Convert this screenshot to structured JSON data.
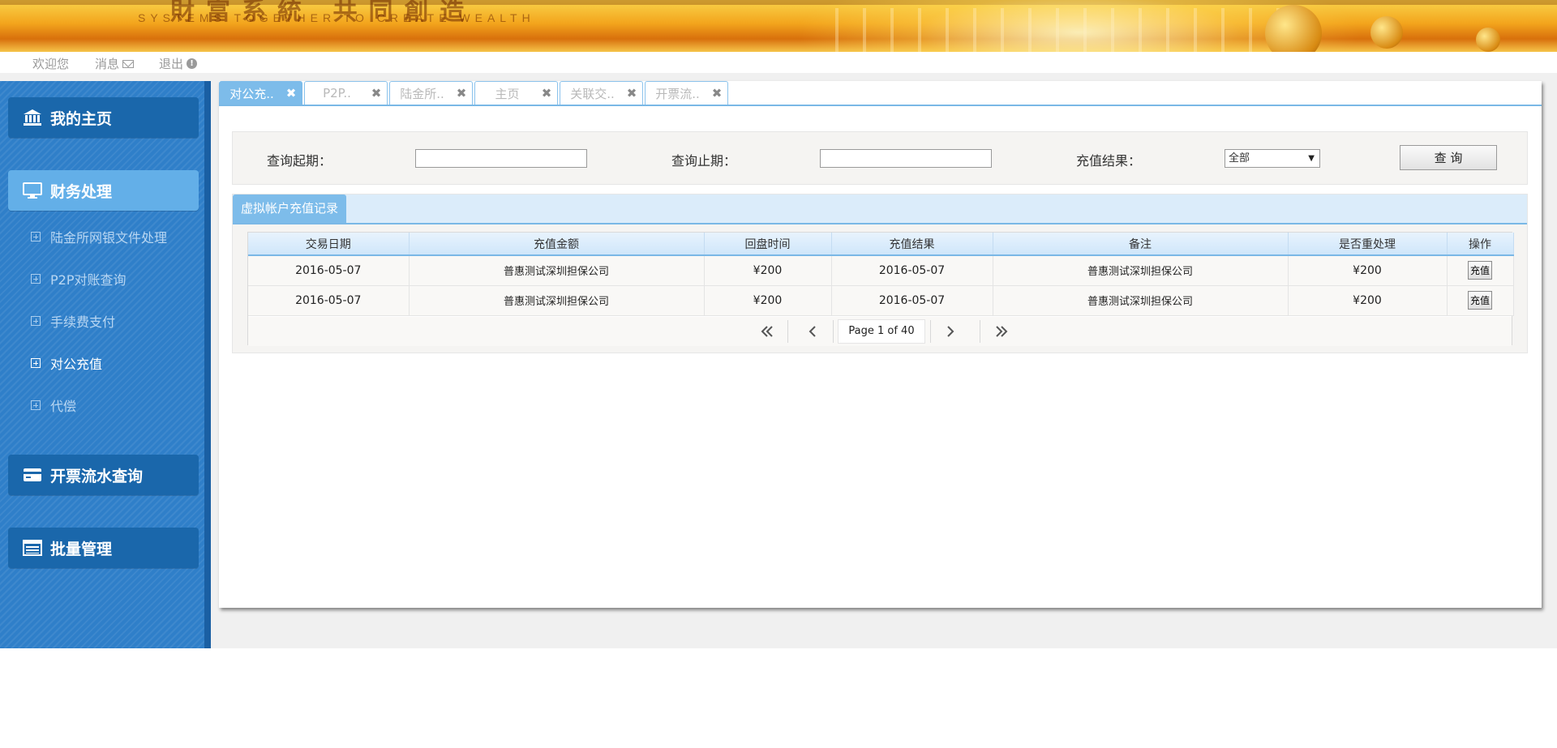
{
  "banner": {
    "slogan_cn": "財富系統 共同創造",
    "slogan_en": "SYSTEMS TOGETHER TO CREATE WEALTH"
  },
  "topnav": {
    "welcome": "欢迎您",
    "messages": "消息",
    "logout": "退出"
  },
  "sidebar": {
    "menus": [
      {
        "label": "我的主页",
        "icon": "bank-icon"
      },
      {
        "label": "财务处理",
        "icon": "monitor-icon",
        "active": true
      },
      {
        "label": "开票流水查询",
        "icon": "card-icon"
      },
      {
        "label": "批量管理",
        "icon": "list-icon"
      }
    ],
    "sub_items": [
      {
        "label": "陆金所网银文件处理"
      },
      {
        "label": "P2P对账查询"
      },
      {
        "label": "手续费支付"
      },
      {
        "label": "对公充值",
        "active": true
      },
      {
        "label": "代偿"
      }
    ]
  },
  "tabs": [
    {
      "label": "对公充..",
      "active": true
    },
    {
      "label": "P2P.."
    },
    {
      "label": "陆金所.."
    },
    {
      "label": "主页"
    },
    {
      "label": "关联交.."
    },
    {
      "label": "开票流.."
    }
  ],
  "query": {
    "start_label": "查询起期：",
    "end_label": "查询止期：",
    "result_label": "充值结果：",
    "start_value": "",
    "end_value": "",
    "result_selected": "全部",
    "button_label": "查 询"
  },
  "grid": {
    "title": "虚拟帐户充值记录",
    "columns": [
      "交易日期",
      "充值金额",
      "回盘时间",
      "充值结果",
      "备注",
      "是否重处理",
      "操作"
    ],
    "rows": [
      {
        "date": "2016-05-07",
        "amount": "普惠测试深圳担保公司",
        "time": "¥200",
        "result": "2016-05-07",
        "remark": "普惠测试深圳担保公司",
        "reprocess": "¥200",
        "action": "充值"
      },
      {
        "date": "2016-05-07",
        "amount": "普惠测试深圳担保公司",
        "time": "¥200",
        "result": "2016-05-07",
        "remark": "普惠测试深圳担保公司",
        "reprocess": "¥200",
        "action": "充值"
      }
    ],
    "pager_text": "Page 1 of 40"
  },
  "colors": {
    "sidebar_bg": "#2f7fc9",
    "menu_btn": "#1a67ab",
    "menu_active": "#63afe8",
    "accent": "#7dbcea"
  }
}
